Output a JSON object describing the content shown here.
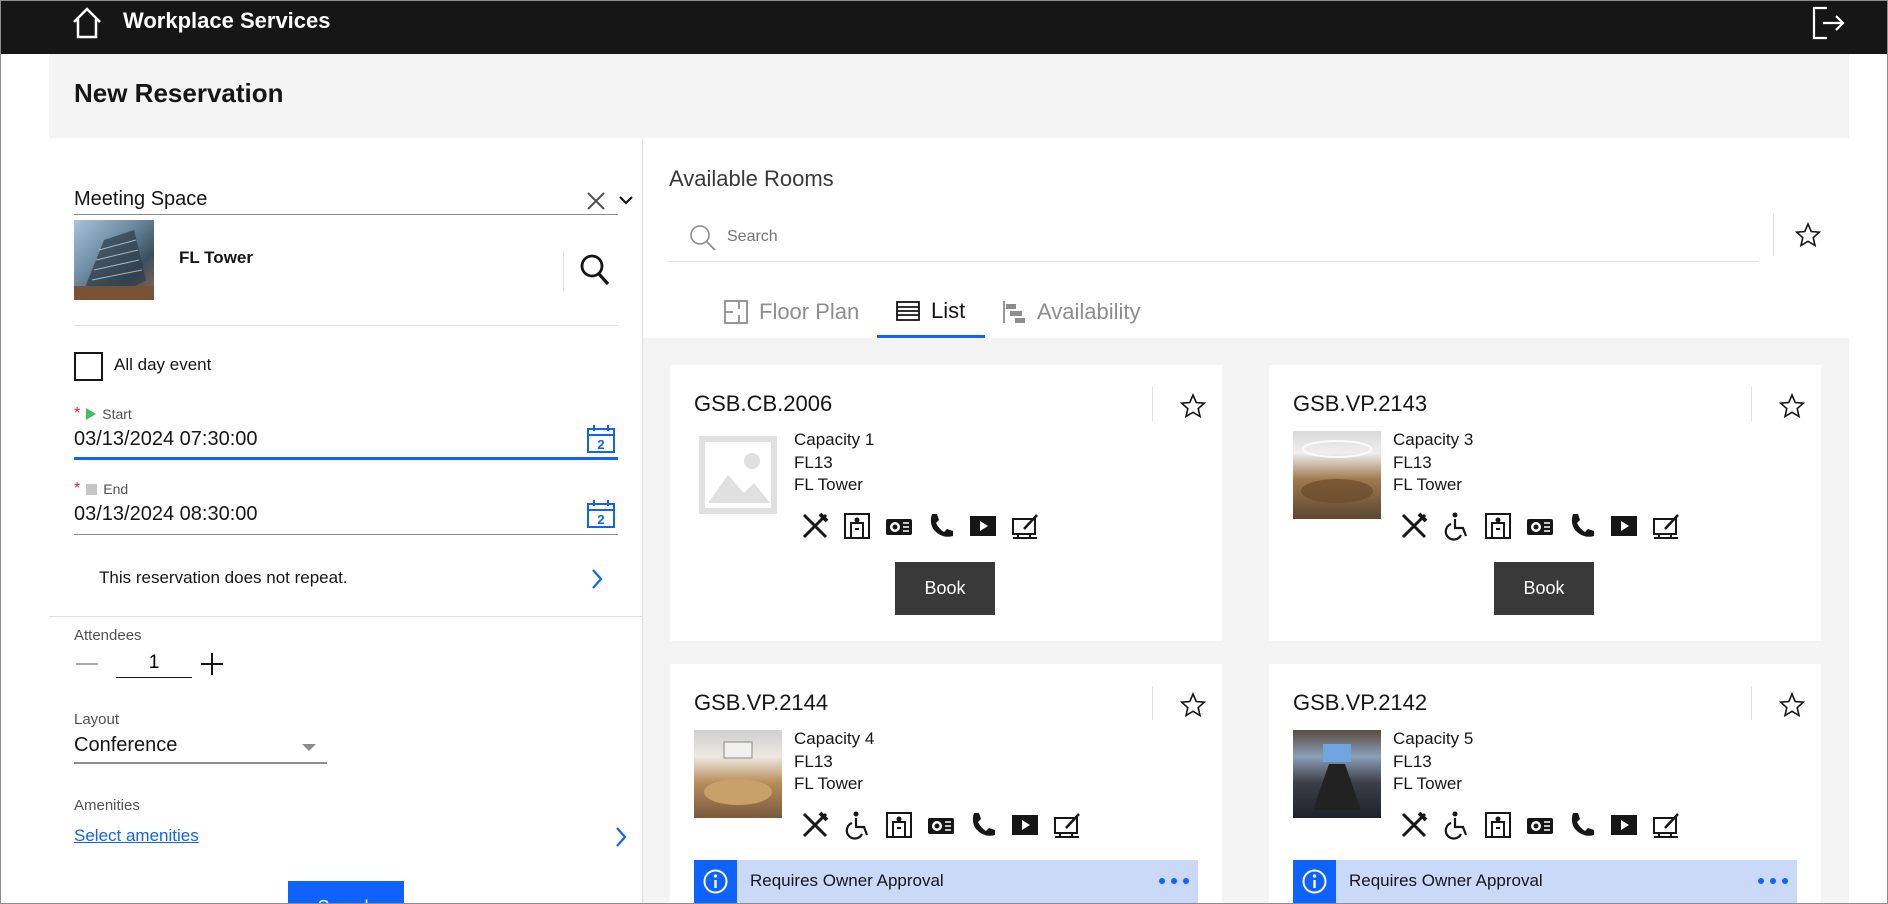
{
  "header": {
    "app_title": "Workplace Services"
  },
  "page": {
    "title": "New Reservation"
  },
  "form": {
    "space_type": "Meeting Space",
    "building": {
      "name": "FL Tower"
    },
    "all_day_label": "All day event",
    "start": {
      "label": "Start",
      "value": "03/13/2024 07:30:00"
    },
    "end": {
      "label": "End",
      "value": "03/13/2024 08:30:00"
    },
    "calendar_day": "2",
    "repeat_text": "This reservation does not repeat.",
    "attendees": {
      "label": "Attendees",
      "value": "1"
    },
    "layout": {
      "label": "Layout",
      "value": "Conference"
    },
    "amenities": {
      "label": "Amenities",
      "link_text": "Select amenities"
    },
    "search_button": "Search"
  },
  "rooms_panel": {
    "title": "Available Rooms",
    "search_placeholder": "Search",
    "tabs": [
      {
        "label": "Floor Plan",
        "active": false
      },
      {
        "label": "List",
        "active": true
      },
      {
        "label": "Availability",
        "active": false
      }
    ],
    "rooms": [
      {
        "name": "GSB.CB.2006",
        "capacity": "Capacity 1",
        "floor": "FL13",
        "building": "FL Tower",
        "action": "Book",
        "amenities": [
          "food-service-icon",
          "floor-plan-icon",
          "projector-icon",
          "phone-icon",
          "video-icon",
          "whiteboard-icon"
        ]
      },
      {
        "name": "GSB.VP.2143",
        "capacity": "Capacity 3",
        "floor": "FL13",
        "building": "FL Tower",
        "action": "Book",
        "amenities": [
          "food-service-icon",
          "accessible-icon",
          "floor-plan-icon",
          "projector-icon",
          "phone-icon",
          "video-icon",
          "whiteboard-icon"
        ]
      },
      {
        "name": "GSB.VP.2144",
        "capacity": "Capacity 4",
        "floor": "FL13",
        "building": "FL Tower",
        "notice": "Requires Owner Approval",
        "amenities": [
          "food-service-icon",
          "accessible-icon",
          "floor-plan-icon",
          "projector-icon",
          "phone-icon",
          "video-icon",
          "whiteboard-icon"
        ]
      },
      {
        "name": "GSB.VP.2142",
        "capacity": "Capacity 5",
        "floor": "FL13",
        "building": "FL Tower",
        "notice": "Requires Owner Approval",
        "amenities": [
          "food-service-icon",
          "accessible-icon",
          "floor-plan-icon",
          "projector-icon",
          "phone-icon",
          "video-icon",
          "whiteboard-icon"
        ]
      }
    ]
  },
  "colors": {
    "accent": "#0f62fe",
    "topbar": "#161616",
    "notice_bg": "#c9d9f7"
  }
}
